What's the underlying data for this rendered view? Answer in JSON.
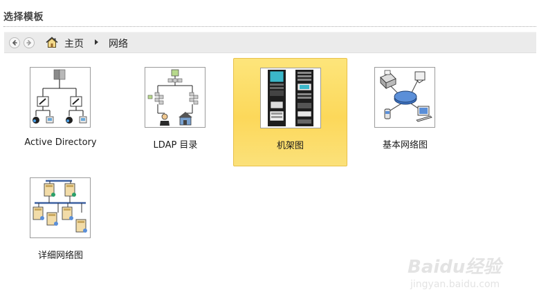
{
  "title": "选择模板",
  "breadcrumb": {
    "home_label": "主页",
    "current_label": "网络"
  },
  "templates": [
    {
      "label": "Active Directory",
      "icon": "active-directory-icon",
      "selected": false
    },
    {
      "label": "LDAP 目录",
      "icon": "ldap-directory-icon",
      "selected": false
    },
    {
      "label": "机架图",
      "icon": "rack-diagram-icon",
      "selected": true
    },
    {
      "label": "基本网络图",
      "icon": "basic-network-icon",
      "selected": false
    },
    {
      "label": "详细网络图",
      "icon": "detailed-network-icon",
      "selected": false
    }
  ],
  "watermark": {
    "brand": "Baidu经验",
    "url": "jingyan.baidu.com"
  },
  "colors": {
    "selected_fill": "#fcd85a",
    "selected_border": "#e7c04a",
    "navbar_bg": "#ebebeb"
  }
}
